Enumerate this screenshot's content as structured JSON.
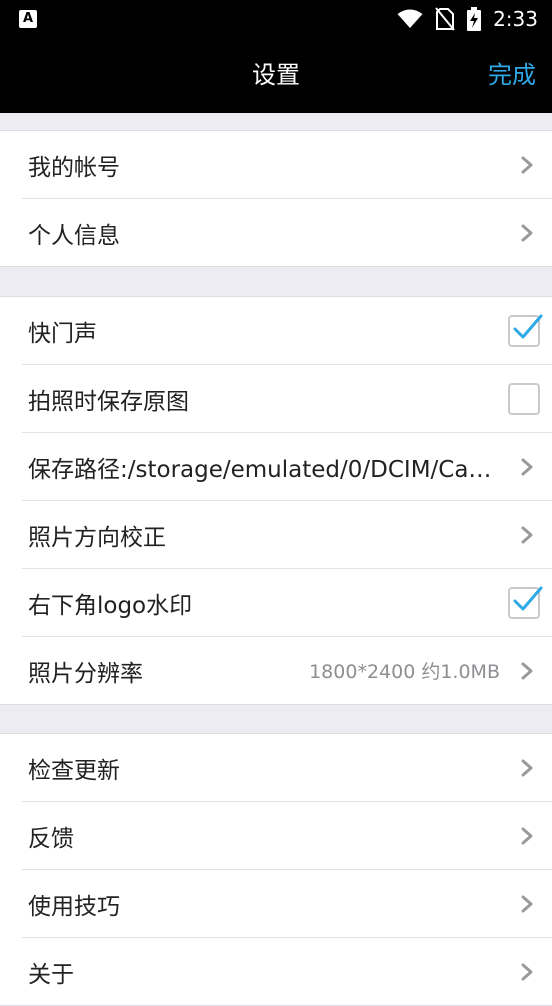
{
  "status_bar": {
    "left_icon": "A",
    "time": "2:33"
  },
  "header": {
    "title": "设置",
    "done_label": "完成"
  },
  "colors": {
    "accent": "#2fa9e6",
    "background": "#ececf2",
    "checkmark": "#2fa9e6"
  },
  "groups": [
    {
      "rows": [
        {
          "label": "我的帐号",
          "control": "chevron"
        },
        {
          "label": "个人信息",
          "control": "chevron"
        }
      ]
    },
    {
      "rows": [
        {
          "label": "快门声",
          "control": "checkbox",
          "checked": true
        },
        {
          "label": "拍照时保存原图",
          "control": "checkbox",
          "checked": false
        },
        {
          "label": "保存路径:/storage/emulated/0/DCIM/Ca…",
          "control": "chevron"
        },
        {
          "label": "照片方向校正",
          "control": "chevron"
        },
        {
          "label": "右下角logo水印",
          "control": "checkbox",
          "checked": true
        },
        {
          "label": "照片分辨率",
          "value": "1800*2400 约1.0MB",
          "control": "chevron"
        }
      ]
    },
    {
      "rows": [
        {
          "label": "检查更新",
          "control": "chevron"
        },
        {
          "label": "反馈",
          "control": "chevron"
        },
        {
          "label": "使用技巧",
          "control": "chevron"
        },
        {
          "label": "关于",
          "control": "chevron"
        }
      ]
    }
  ]
}
